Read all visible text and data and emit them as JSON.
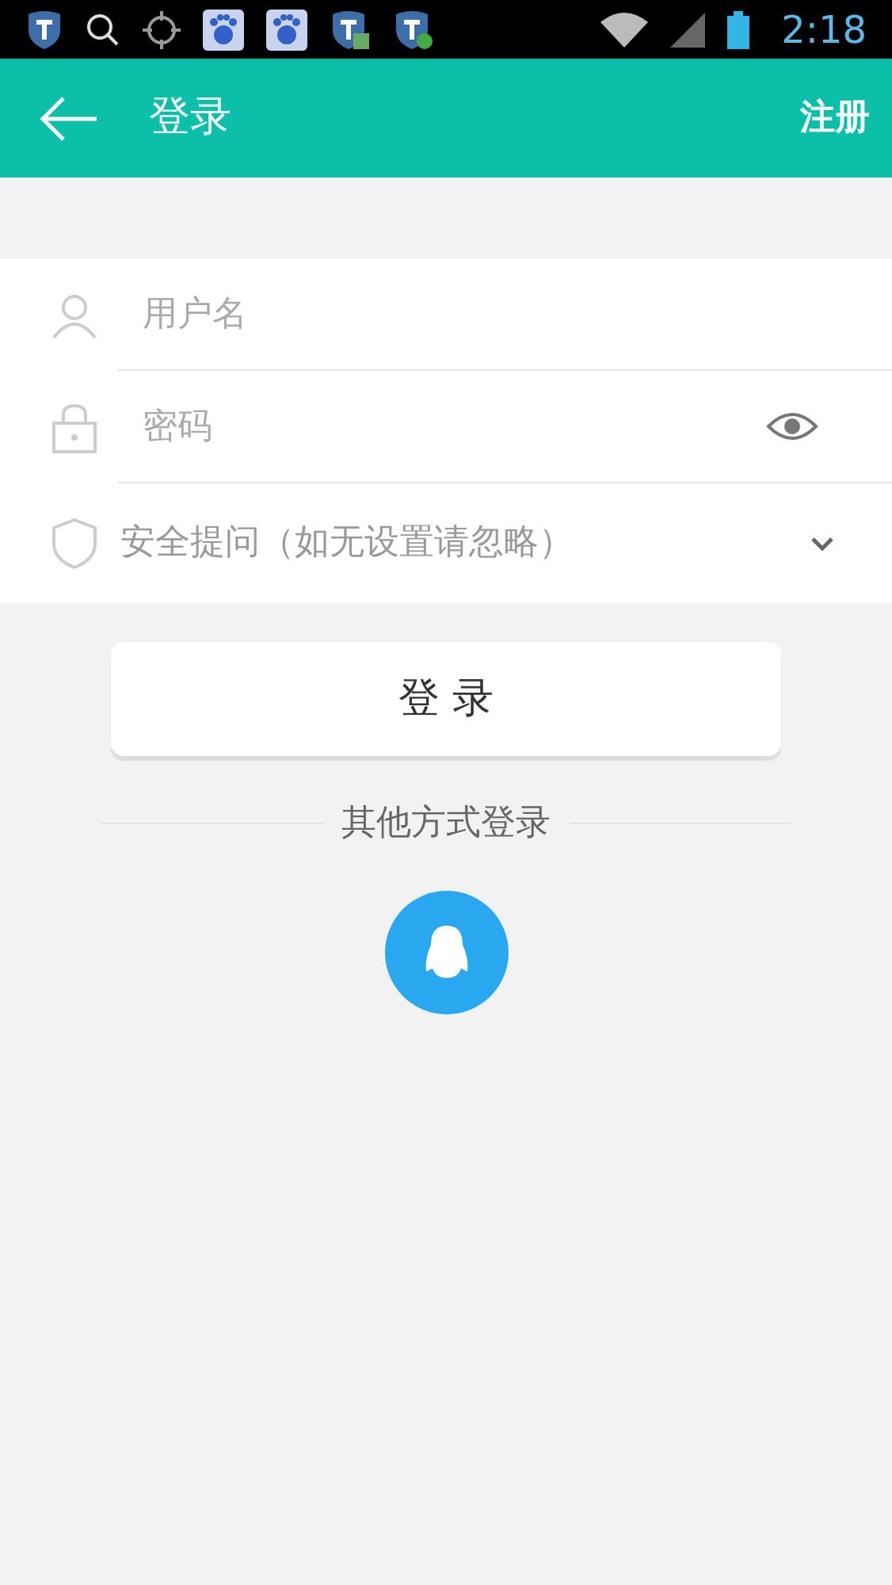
{
  "status_bar": {
    "time": "2:18"
  },
  "header": {
    "title": "登录",
    "action": "注册"
  },
  "fields": [
    {
      "kind": "username",
      "placeholder": "用户名"
    },
    {
      "kind": "password",
      "placeholder": "密码"
    }
  ],
  "security_question": {
    "placeholder": "安全提问（如无设置请忽略）"
  },
  "login_button": "登 录",
  "other_login": {
    "label": "其他方式登录"
  }
}
